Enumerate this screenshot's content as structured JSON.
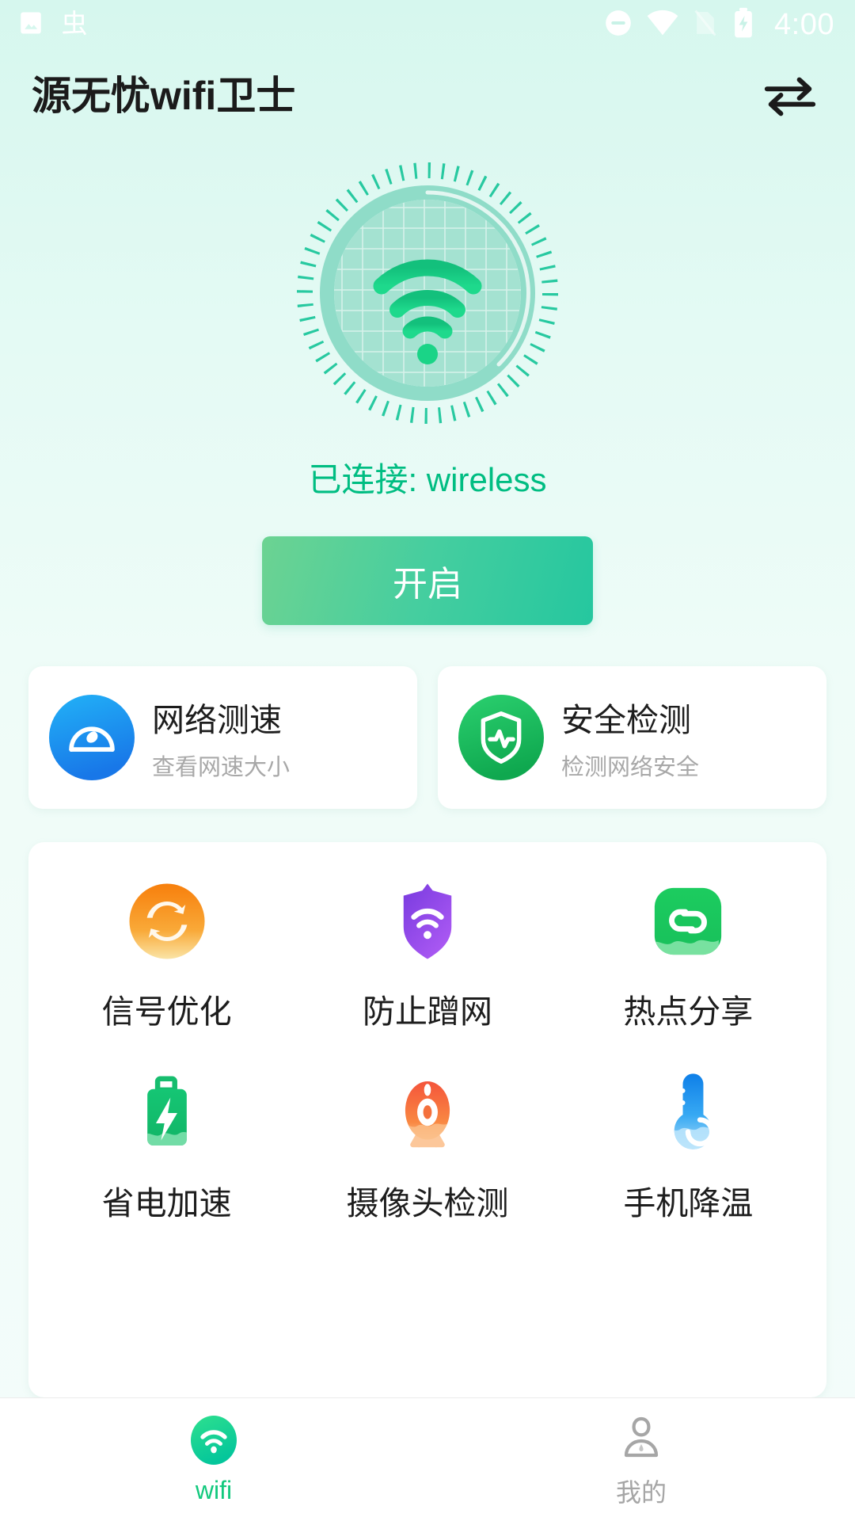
{
  "status_bar": {
    "time": "4:00",
    "left_icons": [
      "image-icon",
      "bug-icon"
    ],
    "right_icons": [
      "do-not-disturb-icon",
      "wifi-icon",
      "no-sim-icon",
      "battery-charging-icon"
    ],
    "icon_color": "#ffffff"
  },
  "header": {
    "title": "源无忧wifi卫士",
    "action_icon": "swap-arrows-icon"
  },
  "radar": {
    "icon": "wifi-signal-icon",
    "ring_color": "#8ed9c4",
    "signal_color": "#18c87e",
    "tick_color": "#27c9a0"
  },
  "connection": {
    "status_text": "已连接: wireless",
    "status_color": "#00bd82"
  },
  "primary_button": {
    "label": "开启",
    "gradient_from": "#6cd392",
    "gradient_to": "#25c79f"
  },
  "feature_cards": [
    {
      "title": "网络测速",
      "subtitle": "查看网速大小",
      "icon": "speedometer-icon",
      "color": "#1e9ef4"
    },
    {
      "title": "安全检测",
      "subtitle": "检测网络安全",
      "icon": "shield-pulse-icon",
      "color": "#1fc065"
    }
  ],
  "tool_grid": {
    "rows": [
      [
        {
          "label": "信号优化",
          "icon": "refresh-circle-icon",
          "color": "#f7931e"
        },
        {
          "label": "防止蹭网",
          "icon": "shield-wifi-icon",
          "color": "#9045e8"
        },
        {
          "label": "热点分享",
          "icon": "hotspot-share-icon",
          "color": "#1fcb5f"
        }
      ],
      [
        {
          "label": "省电加速",
          "icon": "battery-bolt-icon",
          "color": "#18bd6f"
        },
        {
          "label": "摄像头检测",
          "icon": "webcam-icon",
          "color": "#f4603c"
        },
        {
          "label": "手机降温",
          "icon": "thermometer-icon",
          "color": "#1284ec"
        }
      ]
    ]
  },
  "bottom_nav": {
    "items": [
      {
        "label": "wifi",
        "icon": "wifi-tab-icon",
        "active": true
      },
      {
        "label": "我的",
        "icon": "person-tab-icon",
        "active": false
      }
    ],
    "active_color": "#13c97e",
    "inactive_color": "#a6a6a6"
  }
}
